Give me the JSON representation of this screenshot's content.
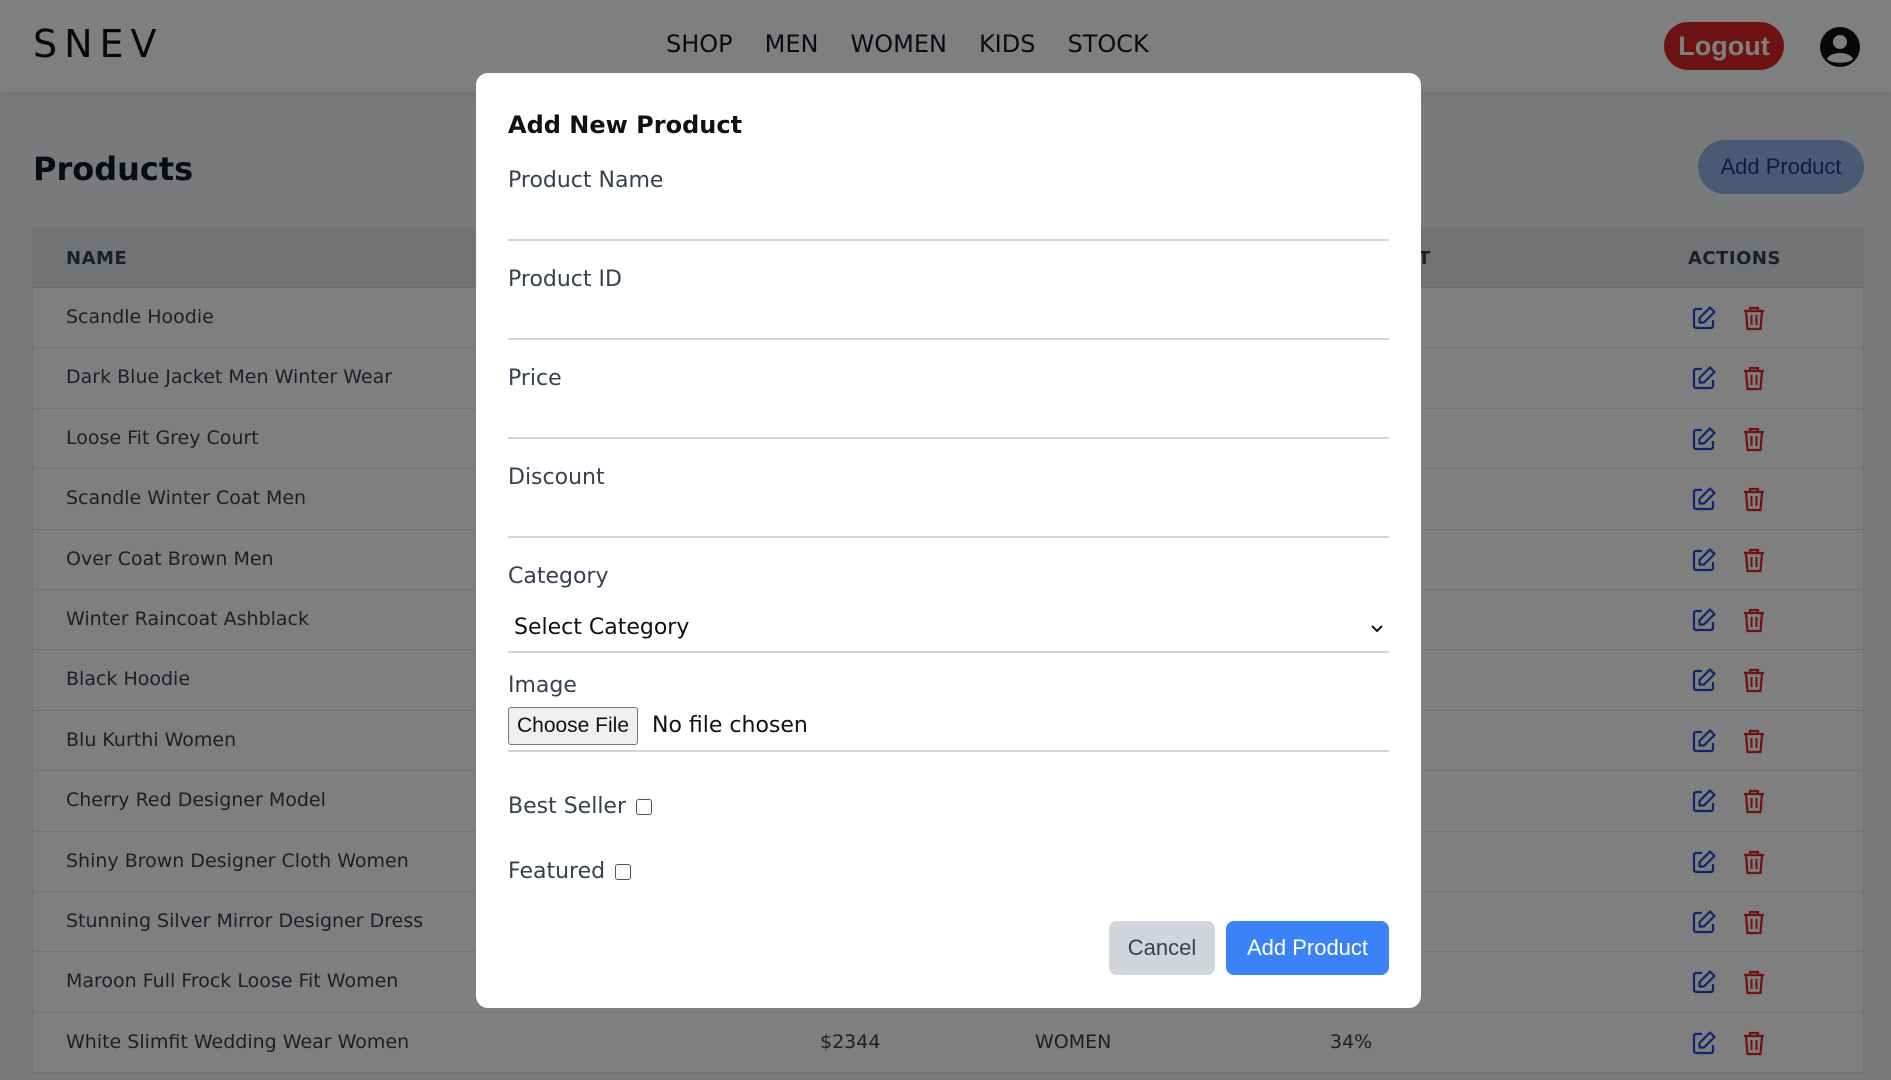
{
  "header": {
    "logo": "SNEV",
    "nav": [
      "SHOP",
      "MEN",
      "WOMEN",
      "KIDS",
      "STOCK"
    ],
    "logout_label": "Logout",
    "avatar_icon": "user-circle-icon"
  },
  "page": {
    "title": "Products",
    "add_button_label": "Add Product"
  },
  "table": {
    "headers": {
      "name": "NAME",
      "actions": "ACTIONS",
      "partial_hidden": "T"
    },
    "rows": [
      {
        "name": "Scandle Hoodie"
      },
      {
        "name": "Dark Blue Jacket Men Winter Wear"
      },
      {
        "name": "Loose Fit Grey Court"
      },
      {
        "name": "Scandle Winter Coat Men"
      },
      {
        "name": "Over Coat Brown Men"
      },
      {
        "name": "Winter Raincoat Ashblack"
      },
      {
        "name": "Black Hoodie"
      },
      {
        "name": "Blu Kurthi Women"
      },
      {
        "name": "Cherry Red Designer Model"
      },
      {
        "name": "Shiny Brown Designer Cloth Women"
      },
      {
        "name": "Stunning Silver Mirror Designer Dress"
      },
      {
        "name": "Maroon Full Frock Loose Fit Women"
      },
      {
        "name": "White Slimfit Wedding Wear Women",
        "price": "$2344",
        "category": "WOMEN",
        "discount": "34%"
      }
    ],
    "edit_icon": "edit-icon",
    "delete_icon": "trash-icon",
    "colors": {
      "edit": "#1d4ed8",
      "delete": "#dc2626"
    }
  },
  "modal": {
    "title": "Add New Product",
    "fields": {
      "product_name": {
        "label": "Product Name",
        "value": ""
      },
      "product_id": {
        "label": "Product ID",
        "value": ""
      },
      "price": {
        "label": "Price",
        "value": ""
      },
      "discount": {
        "label": "Discount",
        "value": ""
      }
    },
    "category": {
      "label": "Category",
      "selected": "Select Category"
    },
    "image": {
      "label": "Image",
      "button": "Choose File",
      "status": "No file chosen"
    },
    "best_seller": {
      "label": "Best Seller",
      "checked": false
    },
    "featured": {
      "label": "Featured",
      "checked": false
    },
    "cancel_label": "Cancel",
    "submit_label": "Add Product"
  }
}
